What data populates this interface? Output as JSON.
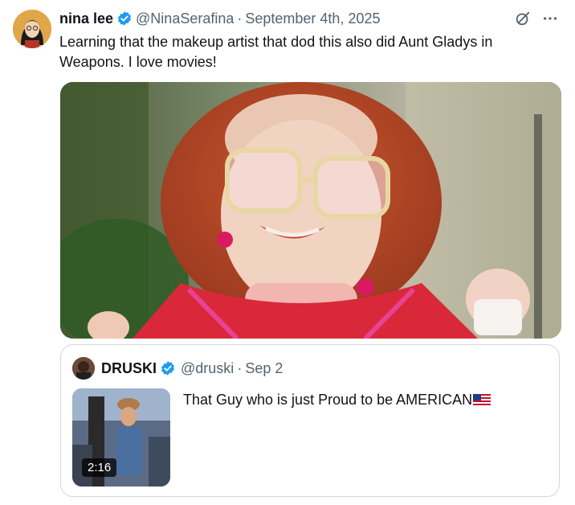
{
  "tweet": {
    "author_name": "nina lee",
    "handle": "@NinaSerafina",
    "separator": "·",
    "date": "September 4th, 2025",
    "text": "Learning that the makeup artist that dod this also did Aunt Gladys in Weapons. I love movies!",
    "icons": [
      "avatar",
      "verified-badge-icon",
      "grok-icon",
      "more-icon"
    ]
  },
  "quoted": {
    "author_name": "DRUSKI",
    "handle": "@druski",
    "separator": "·",
    "date": "Sep 2",
    "text": "That Guy who is just Proud to be AMERICAN",
    "video_duration": "2:16",
    "icons": [
      "verified-badge-icon",
      "us-flag-emoji"
    ]
  },
  "colors": {
    "text": "#0f1419",
    "secondary": "#536471",
    "verified": "#1d9bf0",
    "border": "#cfd9de"
  }
}
